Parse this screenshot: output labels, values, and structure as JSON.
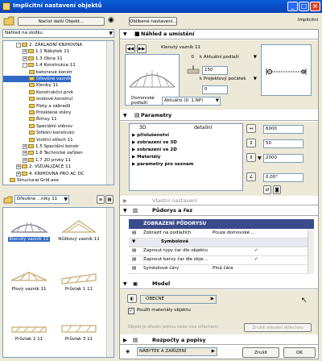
{
  "window": {
    "title": "Implicitní nastavení objektů",
    "minimize": "_",
    "maximize": "□",
    "close": "×"
  },
  "toolbar": {
    "load_button": "Načíst další Objekt...",
    "favorites_button": "Oblíbené nastavení...",
    "default_label": "Implicitní"
  },
  "left": {
    "view_select": "Náhled na složku",
    "tree": [
      {
        "indent": 2,
        "label": "2. ZÁKLADNÍ KNIHOVNA",
        "exp": "-"
      },
      {
        "indent": 3,
        "label": "1.1 Nábytek 11",
        "exp": "+"
      },
      {
        "indent": 3,
        "label": "1.3 Okna 11",
        "exp": "+"
      },
      {
        "indent": 3,
        "label": "1.4 Konstrukce 11",
        "exp": "-"
      },
      {
        "indent": 4,
        "label": "betonové konstr",
        "exp": ""
      },
      {
        "indent": 4,
        "label": "Dřevěné vazník",
        "exp": "",
        "selected": true
      },
      {
        "indent": 4,
        "label": "Klenby 11",
        "exp": ""
      },
      {
        "indent": 4,
        "label": "Konstrukční prvk",
        "exp": ""
      },
      {
        "indent": 4,
        "label": "ocelové konstrul",
        "exp": ""
      },
      {
        "indent": 4,
        "label": "Ploty a zábradlí",
        "exp": ""
      },
      {
        "indent": 4,
        "label": "Prosklené stěny",
        "exp": ""
      },
      {
        "indent": 4,
        "label": "Římsy 11",
        "exp": ""
      },
      {
        "indent": 4,
        "label": "Speciální stěnov",
        "exp": ""
      },
      {
        "indent": 4,
        "label": "Střešní konstrukc",
        "exp": ""
      },
      {
        "indent": 4,
        "label": "Vnitřní střech 11",
        "exp": ""
      },
      {
        "indent": 3,
        "label": "1.5 Speciální konstr",
        "exp": "+"
      },
      {
        "indent": 3,
        "label": "1.6 Technické zařízen",
        "exp": "+"
      },
      {
        "indent": 3,
        "label": "1.7 2D prvky 11",
        "exp": "+"
      },
      {
        "indent": 2,
        "label": "2. VIZUALIZACE 11",
        "exp": "+"
      },
      {
        "indent": 2,
        "label": "4. KNIHOVNA PRO AC DC",
        "exp": "+"
      },
      {
        "indent": 1,
        "label": "Structural Grid.aox",
        "exp": ""
      }
    ],
    "folder_select": "Dřevěné ...níky 11",
    "objects": [
      {
        "label": "Klenutý vazník 11",
        "selected": true
      },
      {
        "label": "Nůžkový vazník 11",
        "selected": false
      },
      {
        "label": "Plový vazník 11",
        "selected": false
      },
      {
        "label": "Průvlak 1 11",
        "selected": false
      },
      {
        "label": "Průvlak 2 11",
        "selected": false
      },
      {
        "label": "Průvlak 3 11",
        "selected": false
      }
    ]
  },
  "preview": {
    "header": "Náhled a umístění",
    "object_name": "Klenutý vazník 11",
    "height_offset": "0",
    "height_ref": "k Aktuální podlaží",
    "elevation": "150",
    "elevation_ref": "k Projektový počátek",
    "extra_value": "0",
    "home_floor_label": "Domovské podlaží:",
    "home_floor_value": "Aktuální (0. 1.NP)"
  },
  "params": {
    "header": "Parametry",
    "col_mode": "3D",
    "col_detail": "detailní",
    "items": [
      "příslušenství",
      "zobrazení ve 3D",
      "zobrazení ve 2D",
      "Materiály",
      "parametry pro seznam"
    ],
    "dim_a": "6000",
    "dim_b": "50",
    "dim_c": "2000",
    "angle": "0,00°"
  },
  "custom": {
    "header": "Vlastní nastavení"
  },
  "plan": {
    "header": "Půdorys a řez",
    "table_title": "ZOBRAZENÍ PŮDORYSU",
    "rows": [
      {
        "label": "Zobrazit na podlažích",
        "value": "Pouze domovské ..."
      },
      {
        "label": "Symbolová",
        "value": "",
        "group": true
      },
      {
        "label": "Zapnout typy čar dle objektu",
        "value": "✓"
      },
      {
        "label": "Zapnout barvy čar dle obje...",
        "value": "✓"
      },
      {
        "label": "Symbolové čáry",
        "value": "Plná čára"
      }
    ]
  },
  "model": {
    "header": "Model",
    "material": "OBECNÉ",
    "use_materials": "Použít materiály objektu",
    "note": "Objekt je ořezán jednou nebo více střechami",
    "trim_button": "Zrušit ořezání střechou"
  },
  "bottom": {
    "listing": "Rozpočty a popisy",
    "layer": "NÁBYTEK A ZAŘÍZENÍ",
    "cancel": "Zrušit",
    "ok": "OK"
  }
}
